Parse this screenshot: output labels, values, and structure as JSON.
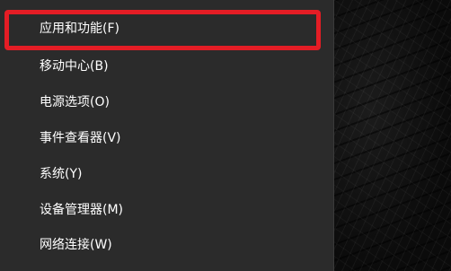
{
  "context_menu": {
    "items": [
      {
        "label": "应用和功能(F)"
      },
      {
        "label": "移动中心(B)"
      },
      {
        "label": "电源选项(O)"
      },
      {
        "label": "事件查看器(V)"
      },
      {
        "label": "系统(Y)"
      },
      {
        "label": "设备管理器(M)"
      },
      {
        "label": "网络连接(W)"
      }
    ],
    "highlighted_index": 0,
    "colors": {
      "background": "#2b2b2b",
      "text": "#ffffff",
      "highlight_border": "#e41d25"
    }
  },
  "desktop": {
    "wallpaper": "dark leather texture"
  }
}
